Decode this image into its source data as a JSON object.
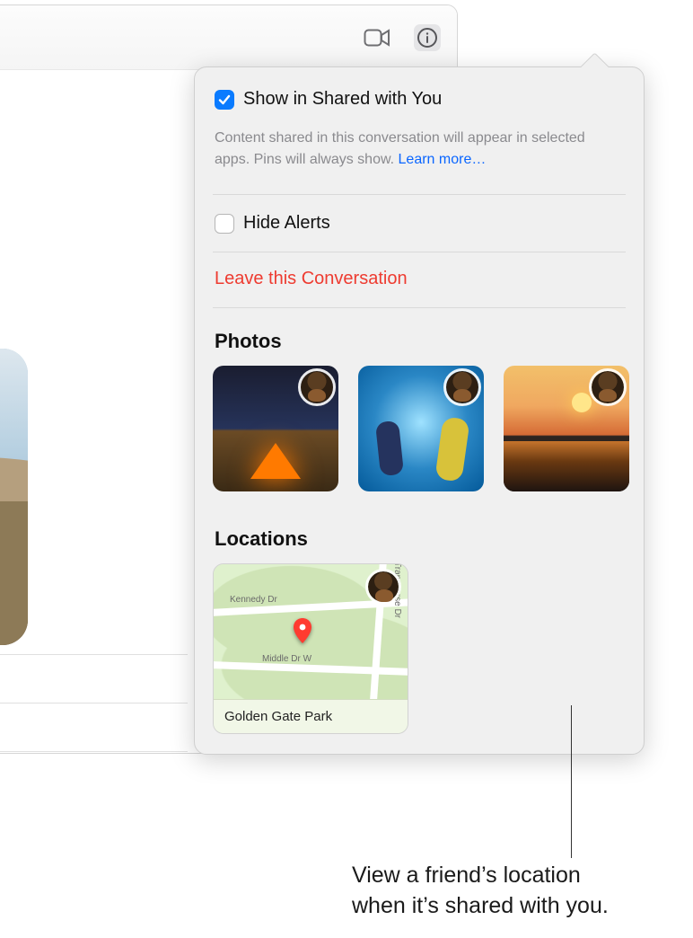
{
  "toolbar": {
    "video_icon": "video-icon",
    "info_icon": "info-icon"
  },
  "details": {
    "show_shared": {
      "label": "Show in Shared with You",
      "checked": true
    },
    "helper_text": "Content shared in this conversation will appear in selected apps. Pins will always show. ",
    "learn_more": "Learn more…",
    "hide_alerts": {
      "label": "Hide Alerts",
      "checked": false
    },
    "leave_label": "Leave this Conversation",
    "photos_title": "Photos",
    "locations_title": "Locations",
    "location": {
      "name": "Golden Gate Park",
      "roads": {
        "kennedy": "Kennedy Dr",
        "middle": "Middle Dr W",
        "transverse": "Transverse Dr"
      }
    }
  },
  "callout": {
    "line1": "View a friend’s location",
    "line2": "when it’s shared with you."
  }
}
